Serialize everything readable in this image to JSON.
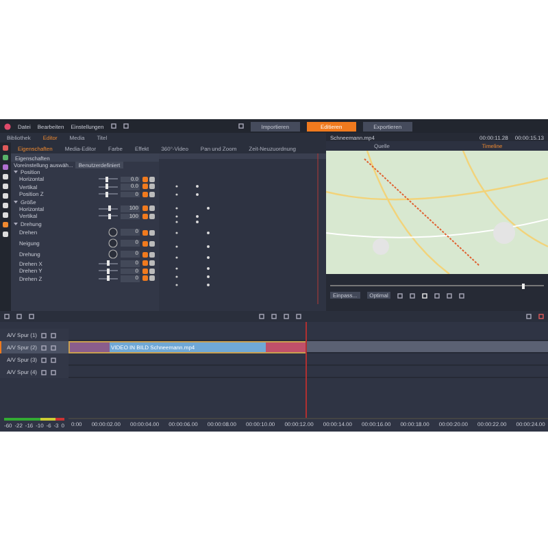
{
  "menu": [
    "Datei",
    "Bearbeiten",
    "Einstellungen"
  ],
  "modes": [
    {
      "label": "Importieren",
      "selected": false
    },
    {
      "label": "Editieren",
      "selected": true
    },
    {
      "label": "Exportieren",
      "selected": false
    }
  ],
  "library_tabs": [
    {
      "label": "Bibliothek",
      "selected": false
    },
    {
      "label": "Editor",
      "selected": true
    },
    {
      "label": "Media",
      "selected": false
    },
    {
      "label": "Titel",
      "selected": false
    }
  ],
  "editor_tabs": [
    {
      "label": "Eigenschaften",
      "selected": true
    },
    {
      "label": "Media-Editor",
      "selected": false
    },
    {
      "label": "Farbe",
      "selected": false
    },
    {
      "label": "Effekt",
      "selected": false
    },
    {
      "label": "360°-Video",
      "selected": false
    },
    {
      "label": "Pan und Zoom",
      "selected": false
    },
    {
      "label": "Zeit-Neuzuordnung",
      "selected": false
    }
  ],
  "properties": {
    "title": "Eigenschaften",
    "preset_label": "Voreinstellung auswäh...",
    "preset_value": "Benutzerdefiniert",
    "groups": [
      {
        "name": "Position",
        "expanded": true,
        "rows": [
          {
            "label": "Horizontal",
            "kind": "slider",
            "level": 0.45,
            "value": "0.0"
          },
          {
            "label": "Vertikal",
            "kind": "slider",
            "level": 0.45,
            "value": "0.0"
          },
          {
            "label": "Position Z",
            "kind": "slider",
            "level": 0.45,
            "value": "0"
          }
        ]
      },
      {
        "name": "Größe",
        "expanded": true,
        "rows": [
          {
            "label": "Horizontal",
            "kind": "slider",
            "level": 0.55,
            "value": "100"
          },
          {
            "label": "Vertikal",
            "kind": "slider",
            "level": 0.55,
            "value": "100"
          }
        ]
      },
      {
        "name": "Drehung",
        "expanded": true,
        "rows": [
          {
            "label": "Drehen",
            "kind": "dial",
            "value": "0"
          },
          {
            "label": "Neigung",
            "kind": "dial",
            "value": "0"
          },
          {
            "label": "Drehung",
            "kind": "dial",
            "value": "0"
          },
          {
            "label": "Drehen X",
            "kind": "slider",
            "level": 0.5,
            "value": "0"
          },
          {
            "label": "Drehen Y",
            "kind": "slider",
            "level": 0.5,
            "value": "0"
          },
          {
            "label": "Drehen Z",
            "kind": "slider",
            "level": 0.5,
            "value": "0"
          }
        ]
      }
    ]
  },
  "preview": {
    "filename": "Schneemann.mp4",
    "timecode": "00:00:11.28",
    "duration": "00:00:15.13",
    "tabs": [
      {
        "label": "Quelle",
        "selected": false
      },
      {
        "label": "Timeline",
        "selected": true
      }
    ],
    "scrubber": {
      "level": 0.9
    },
    "zoom": "Einpass...",
    "quality": "Optimal"
  },
  "tracks": [
    {
      "name": "A/V Spur (1)",
      "selected": false
    },
    {
      "name": "A/V Spur (2)",
      "selected": true,
      "clip": "VIDEO IN BILD Schneemann.mp4"
    },
    {
      "name": "A/V Spur (3)",
      "selected": false
    },
    {
      "name": "A/V Spur (4)",
      "selected": false
    }
  ],
  "ruler": [
    "0:00",
    "00:00:02.00",
    "00:00:04.00",
    "00:00:06.00",
    "00:00:08.00",
    "00:00:10.00",
    "00:00:12.00",
    "00:00:14.00",
    "00:00:16.00",
    "00:00:18.00",
    "00:00:20.00",
    "00:00:22.00",
    "00:00:24.00"
  ],
  "meter_scale": [
    "-60",
    "-22",
    "-16",
    "-10",
    "-6",
    "-3",
    "0"
  ]
}
